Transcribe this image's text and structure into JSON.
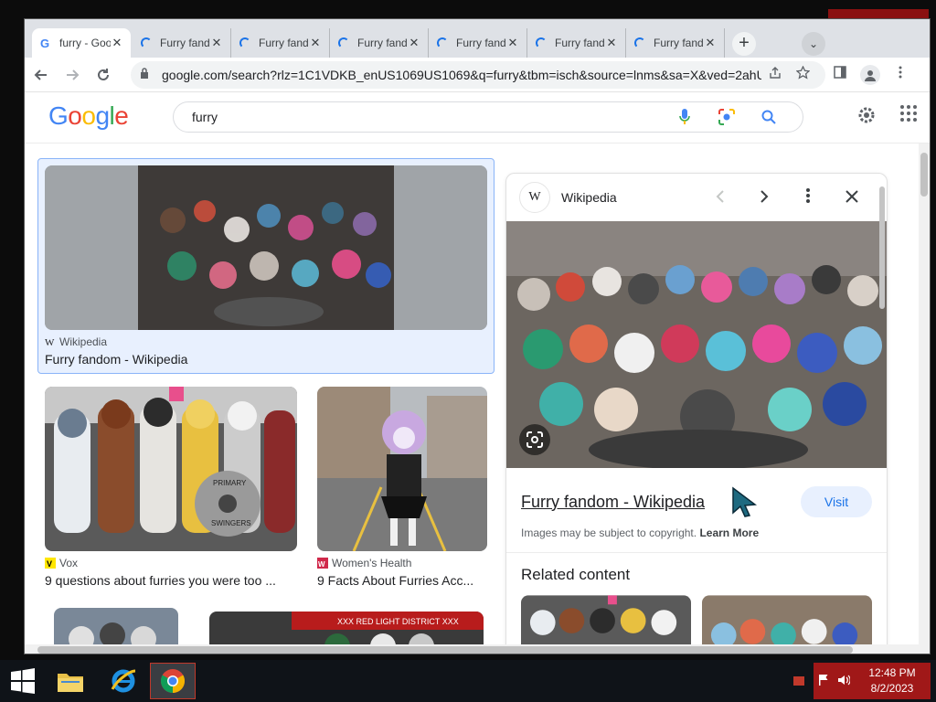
{
  "browser": {
    "tabs": [
      {
        "title": "furry - Google",
        "state": "active",
        "close": "✕"
      },
      {
        "title": "Furry fandom",
        "state": "loading",
        "close": "✕"
      },
      {
        "title": "Furry fandom",
        "state": "loading",
        "close": "✕"
      },
      {
        "title": "Furry fandom",
        "state": "loading",
        "close": "✕"
      },
      {
        "title": "Furry fandom",
        "state": "loading",
        "close": "✕"
      },
      {
        "title": "Furry fandom",
        "state": "loading",
        "close": "✕"
      },
      {
        "title": "Furry fandom",
        "state": "loading",
        "close": "✕"
      }
    ],
    "new_tab": "+",
    "tab_search": "⌄",
    "url": "google.com/search?rlz=1C1VDKB_enUS1069US1069&q=furry&tbm=isch&source=lnms&sa=X&ved=2ahU..."
  },
  "google": {
    "logo_letters": [
      "G",
      "o",
      "o",
      "g",
      "l",
      "e"
    ],
    "query": "furry"
  },
  "results": {
    "selected": {
      "source": "Wikipedia",
      "title": "Furry fandom - Wikipedia"
    },
    "row2": [
      {
        "source": "Vox",
        "title": "9 questions about furries you were too ..."
      },
      {
        "source": "Women's Health",
        "title": "9 Facts About Furries Acc..."
      }
    ]
  },
  "panel": {
    "source": "Wikipedia",
    "title": "Furry fandom - Wikipedia",
    "visit": "Visit",
    "copyright_prefix": "Images may be subject to copyright.",
    "learn_more": "Learn More",
    "related": "Related content"
  },
  "taskbar": {
    "time": "12:48 PM",
    "date": "8/2/2023"
  },
  "colors": {
    "google_blue": "#1a73e8",
    "tray_red": "#a01818",
    "selection_bg": "#e8f0fe"
  }
}
